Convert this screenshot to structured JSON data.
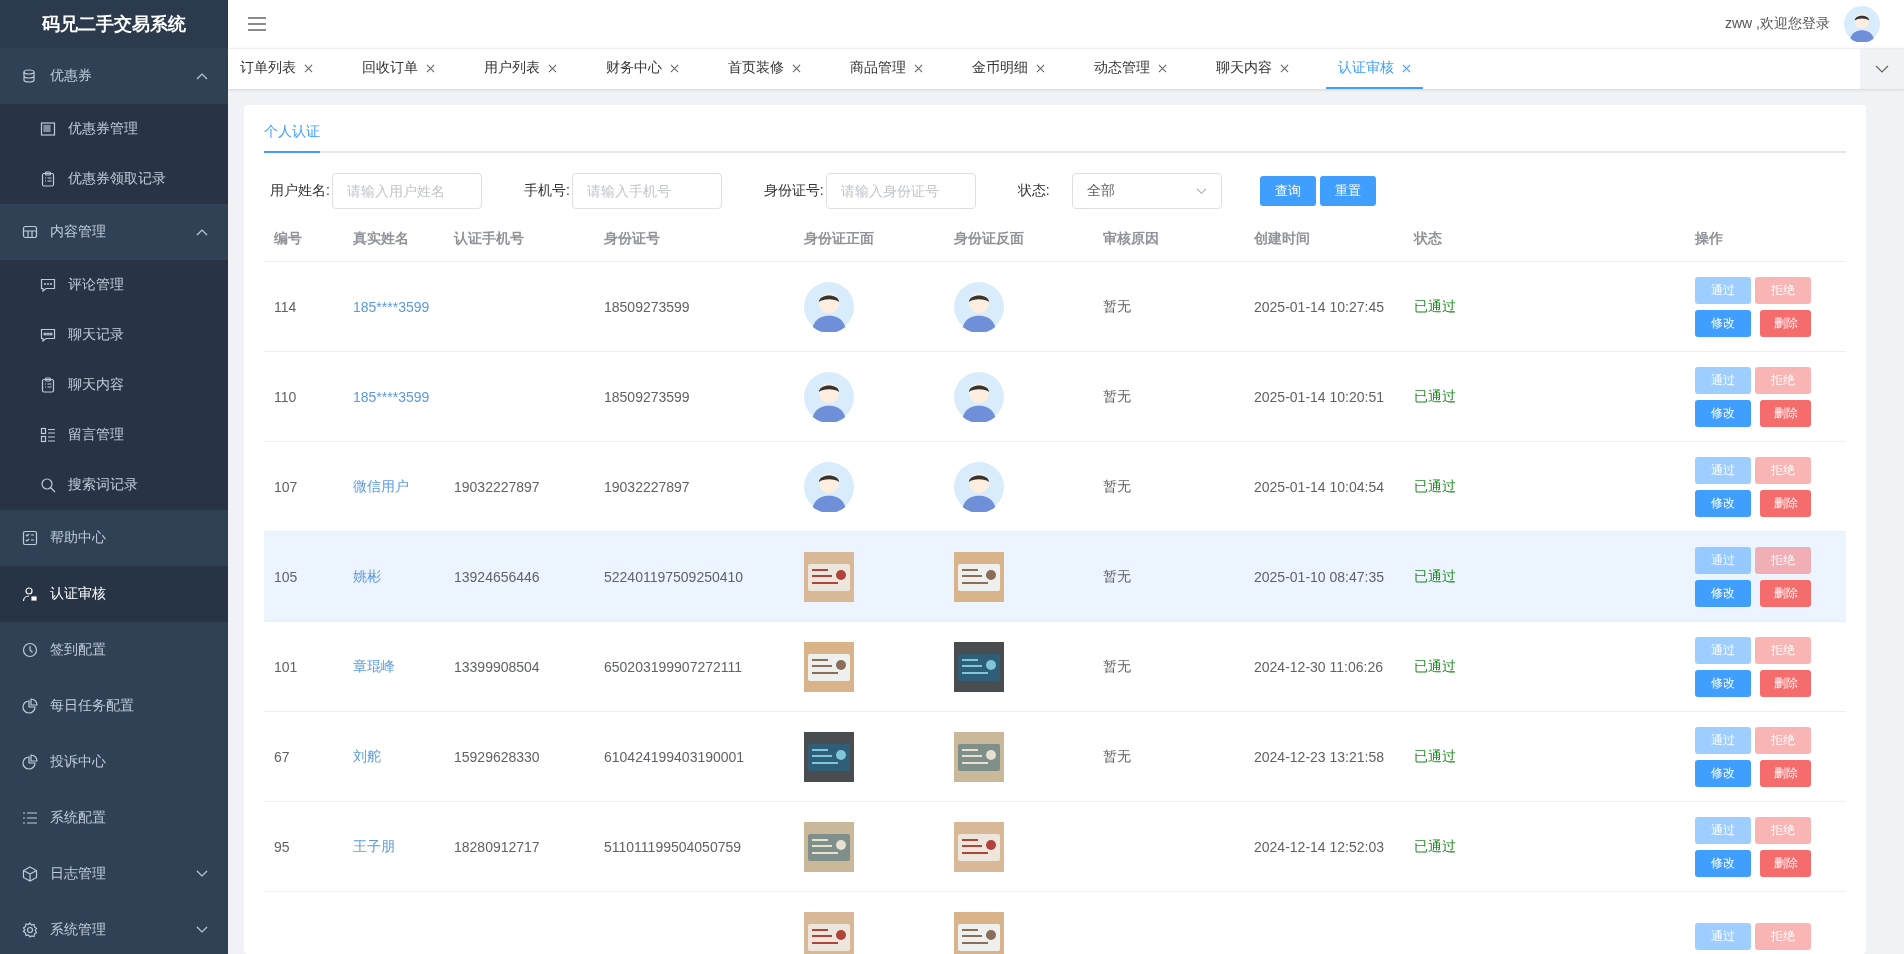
{
  "app": {
    "title": "码兄二手交易系统"
  },
  "sidebar": {
    "items": [
      {
        "kind": "group",
        "label": "优惠券",
        "expanded": true,
        "selected": false,
        "children": [
          {
            "label": "优惠券管理",
            "selected": false
          },
          {
            "label": "优惠券领取记录",
            "selected": false
          }
        ]
      },
      {
        "kind": "group",
        "label": "内容管理",
        "expanded": true,
        "selected": false,
        "children": [
          {
            "label": "评论管理",
            "selected": false
          },
          {
            "label": "聊天记录",
            "selected": false
          },
          {
            "label": "聊天内容",
            "selected": false
          },
          {
            "label": "留言管理",
            "selected": false
          },
          {
            "label": "搜索词记录",
            "selected": false
          }
        ]
      },
      {
        "kind": "link",
        "label": "帮助中心",
        "selected": false
      },
      {
        "kind": "link",
        "label": "认证审核",
        "selected": true
      },
      {
        "kind": "link",
        "label": "签到配置",
        "selected": false
      },
      {
        "kind": "link",
        "label": "每日任务配置",
        "selected": false
      },
      {
        "kind": "link",
        "label": "投诉中心",
        "selected": false
      },
      {
        "kind": "link",
        "label": "系统配置",
        "selected": false
      },
      {
        "kind": "group",
        "label": "日志管理",
        "expanded": false,
        "selected": false
      },
      {
        "kind": "group",
        "label": "系统管理",
        "expanded": false,
        "selected": false
      }
    ]
  },
  "header": {
    "greeting": "zww ,欢迎您登录"
  },
  "tabs": [
    {
      "label": "订单列表",
      "selected": false
    },
    {
      "label": "回收订单",
      "selected": false
    },
    {
      "label": "用户列表",
      "selected": false
    },
    {
      "label": "财务中心",
      "selected": false
    },
    {
      "label": "首页装修",
      "selected": false
    },
    {
      "label": "商品管理",
      "selected": false
    },
    {
      "label": "金币明细",
      "selected": false
    },
    {
      "label": "动态管理",
      "selected": false
    },
    {
      "label": "聊天内容",
      "selected": false
    },
    {
      "label": "认证审核",
      "selected": true
    }
  ],
  "page_tabs": [
    {
      "label": "个人认证",
      "selected": true
    }
  ],
  "filters": [
    {
      "kind": "input",
      "label": "用户姓名:",
      "placeholder": "请输入用户姓名"
    },
    {
      "kind": "input",
      "label": "手机号:",
      "placeholder": "请输入手机号"
    },
    {
      "kind": "input",
      "label": "身份证号:",
      "placeholder": "请输入身份证号"
    },
    {
      "kind": "select",
      "label": "状态:",
      "value": "全部"
    }
  ],
  "filter_buttons": [
    "查询",
    "重置"
  ],
  "table": {
    "columns": [
      "编号",
      "真实姓名",
      "认证手机号",
      "身份证号",
      "身份证正面",
      "身份证反面",
      "审核原因",
      "创建时间",
      "状态",
      "操作"
    ],
    "rows": [
      {
        "id": "114",
        "name": "185****3599",
        "id_number": "18509273599",
        "front": {
          "kind": "avatar"
        },
        "back": {
          "kind": "avatar"
        },
        "reason": "暂无",
        "created": "2025-01-14 10:27:45",
        "status": "已通过",
        "hovered": false,
        "actions": [
          {
            "label": "通过",
            "kind": "approve",
            "disabled": true
          },
          {
            "label": "拒绝",
            "kind": "reject",
            "disabled": true
          },
          {
            "label": "修改",
            "kind": "edit",
            "disabled": false
          },
          {
            "label": "删除",
            "kind": "delete",
            "disabled": false
          }
        ]
      },
      {
        "id": "110",
        "name": "185****3599",
        "id_number": "18509273599",
        "front": {
          "kind": "avatar"
        },
        "back": {
          "kind": "avatar"
        },
        "reason": "暂无",
        "created": "2025-01-14 10:20:51",
        "status": "已通过",
        "hovered": false,
        "actions": [
          {
            "label": "通过",
            "kind": "approve",
            "disabled": true
          },
          {
            "label": "拒绝",
            "kind": "reject",
            "disabled": true
          },
          {
            "label": "修改",
            "kind": "edit",
            "disabled": false
          },
          {
            "label": "删除",
            "kind": "delete",
            "disabled": false
          }
        ]
      },
      {
        "id": "107",
        "name": "微信用户",
        "phone": "19032227897",
        "id_number": "19032227897",
        "front": {
          "kind": "avatar"
        },
        "back": {
          "kind": "avatar"
        },
        "reason": "暂无",
        "created": "2025-01-14 10:04:54",
        "status": "已通过",
        "hovered": false,
        "actions": [
          {
            "label": "通过",
            "kind": "approve",
            "disabled": true
          },
          {
            "label": "拒绝",
            "kind": "reject",
            "disabled": true
          },
          {
            "label": "修改",
            "kind": "edit",
            "disabled": false
          },
          {
            "label": "删除",
            "kind": "delete",
            "disabled": false
          }
        ]
      },
      {
        "id": "105",
        "name": "姚彬",
        "phone": "13924656446",
        "id_number": "522401197509250410",
        "front": {
          "kind": "picture"
        },
        "back": {
          "kind": "picture"
        },
        "reason": "暂无",
        "created": "2025-01-10 08:47:35",
        "status": "已通过",
        "hovered": true,
        "actions": [
          {
            "label": "通过",
            "kind": "approve",
            "disabled": true
          },
          {
            "label": "拒绝",
            "kind": "reject",
            "disabled": true
          },
          {
            "label": "修改",
            "kind": "edit",
            "disabled": false
          },
          {
            "label": "删除",
            "kind": "delete",
            "disabled": false
          }
        ]
      },
      {
        "id": "101",
        "name": "章琨峰",
        "phone": "13399908504",
        "id_number": "650203199907272111",
        "front": {
          "kind": "picture"
        },
        "back": {
          "kind": "picture"
        },
        "reason": "暂无",
        "created": "2024-12-30 11:06:26",
        "status": "已通过",
        "hovered": false,
        "actions": [
          {
            "label": "通过",
            "kind": "approve",
            "disabled": true
          },
          {
            "label": "拒绝",
            "kind": "reject",
            "disabled": true
          },
          {
            "label": "修改",
            "kind": "edit",
            "disabled": false
          },
          {
            "label": "删除",
            "kind": "delete",
            "disabled": false
          }
        ]
      },
      {
        "id": "67",
        "name": "刘舵",
        "phone": "15929628330",
        "id_number": "610424199403190001",
        "front": {
          "kind": "picture"
        },
        "back": {
          "kind": "picture"
        },
        "reason": "暂无",
        "created": "2024-12-23 13:21:58",
        "status": "已通过",
        "hovered": false,
        "actions": [
          {
            "label": "通过",
            "kind": "approve",
            "disabled": true
          },
          {
            "label": "拒绝",
            "kind": "reject",
            "disabled": true
          },
          {
            "label": "修改",
            "kind": "edit",
            "disabled": false
          },
          {
            "label": "删除",
            "kind": "delete",
            "disabled": false
          }
        ]
      },
      {
        "id": "95",
        "name": "王子朋",
        "phone": "18280912717",
        "id_number": "511011199504050759",
        "front": {
          "kind": "picture"
        },
        "back": {
          "kind": "picture"
        },
        "created": "2024-12-14 12:52:03",
        "status": "已通过",
        "hovered": false,
        "actions": [
          {
            "label": "通过",
            "kind": "approve",
            "disabled": true
          },
          {
            "label": "拒绝",
            "kind": "reject",
            "disabled": true
          },
          {
            "label": "修改",
            "kind": "edit",
            "disabled": false
          },
          {
            "label": "删除",
            "kind": "delete",
            "disabled": false
          }
        ]
      },
      {
        "front": {
          "kind": "picture"
        },
        "back": {
          "kind": "picture"
        },
        "hovered": false,
        "actions": [
          {
            "label": "通过",
            "kind": "approve",
            "disabled": true
          },
          {
            "label": "拒绝",
            "kind": "reject",
            "disabled": true
          }
        ]
      }
    ]
  }
}
